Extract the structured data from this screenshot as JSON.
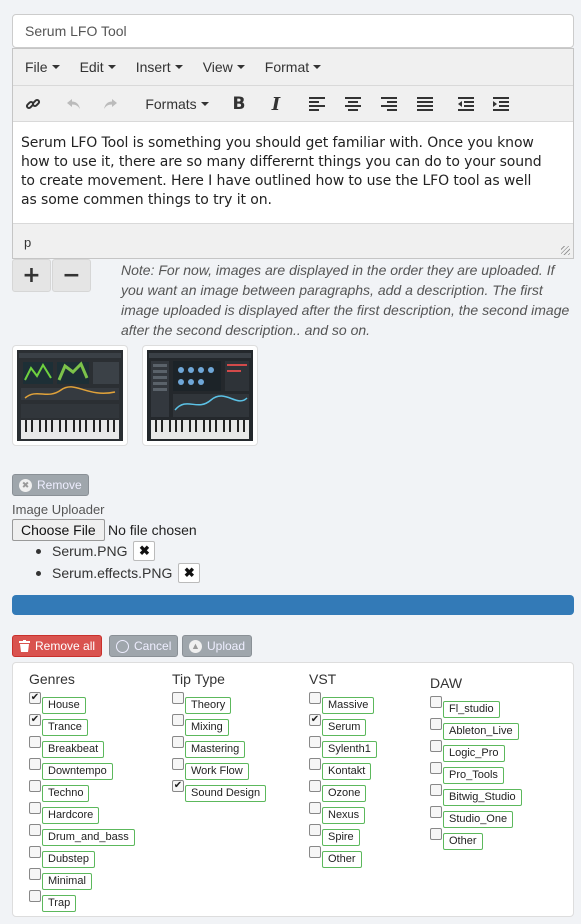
{
  "title_field": {
    "value": "Serum LFO Tool"
  },
  "menubar": [
    "File",
    "Edit",
    "Insert",
    "View",
    "Format"
  ],
  "toolbar": {
    "formats_label": "Formats",
    "bold": "B",
    "italic": "I"
  },
  "editor": {
    "lines": [
      "Serum LFO Tool is something you should get familiar with.  Once you know",
      "how to use it, there are so many differernt things you can do to your sound",
      "to create movement.  Here I have outlined how to use the LFO tool as well",
      "as some commen things to  try it on."
    ],
    "path": "p"
  },
  "image_controls": {
    "add": "+",
    "remove": "−"
  },
  "note": "Note: For now, images are displayed in the order they are uploaded. If you want an image between paragraphs, add a description. The first image uploaded is displayed after the first description, the second image after the second description.. and so on.",
  "remove_button": "Remove",
  "uploader": {
    "label": "Image Uploader",
    "choose_file": "Choose File",
    "no_file": "No file chosen",
    "files": [
      "Serum.PNG",
      "Serum.effects.PNG"
    ],
    "progress": 1.0,
    "progress_color": "#337ab7",
    "remove_all": "Remove all",
    "cancel": "Cancel",
    "upload": "Upload"
  },
  "tags": {
    "genres": {
      "title": "Genres",
      "items": [
        {
          "label": "House",
          "checked": true
        },
        {
          "label": "Trance",
          "checked": true
        },
        {
          "label": "Breakbeat",
          "checked": false
        },
        {
          "label": "Downtempo",
          "checked": false
        },
        {
          "label": "Techno",
          "checked": false
        },
        {
          "label": "Hardcore",
          "checked": false
        },
        {
          "label": "Drum_and_bass",
          "checked": false
        },
        {
          "label": "Dubstep",
          "checked": false
        },
        {
          "label": "Minimal",
          "checked": false
        },
        {
          "label": "Trap",
          "checked": false
        }
      ]
    },
    "tip_type": {
      "title": "Tip Type",
      "items": [
        {
          "label": "Theory",
          "checked": false
        },
        {
          "label": "Mixing",
          "checked": false
        },
        {
          "label": "Mastering",
          "checked": false
        },
        {
          "label": "Work Flow",
          "checked": false
        },
        {
          "label": "Sound Design",
          "checked": true
        }
      ]
    },
    "vst": {
      "title": "VST",
      "items": [
        {
          "label": "Massive",
          "checked": false
        },
        {
          "label": "Serum",
          "checked": true
        },
        {
          "label": "Sylenth1",
          "checked": false
        },
        {
          "label": "Kontakt",
          "checked": false
        },
        {
          "label": "Ozone",
          "checked": false
        },
        {
          "label": "Nexus",
          "checked": false
        },
        {
          "label": "Spire",
          "checked": false
        },
        {
          "label": "Other",
          "checked": false
        }
      ]
    },
    "daw": {
      "title": "DAW",
      "items": [
        {
          "label": "Fl_studio",
          "checked": false
        },
        {
          "label": "Ableton_Live",
          "checked": false
        },
        {
          "label": "Logic_Pro",
          "checked": false
        },
        {
          "label": "Pro_Tools",
          "checked": false
        },
        {
          "label": "Bitwig_Studio",
          "checked": false
        },
        {
          "label": "Studio_One",
          "checked": false
        },
        {
          "label": "Other",
          "checked": false
        }
      ]
    }
  }
}
